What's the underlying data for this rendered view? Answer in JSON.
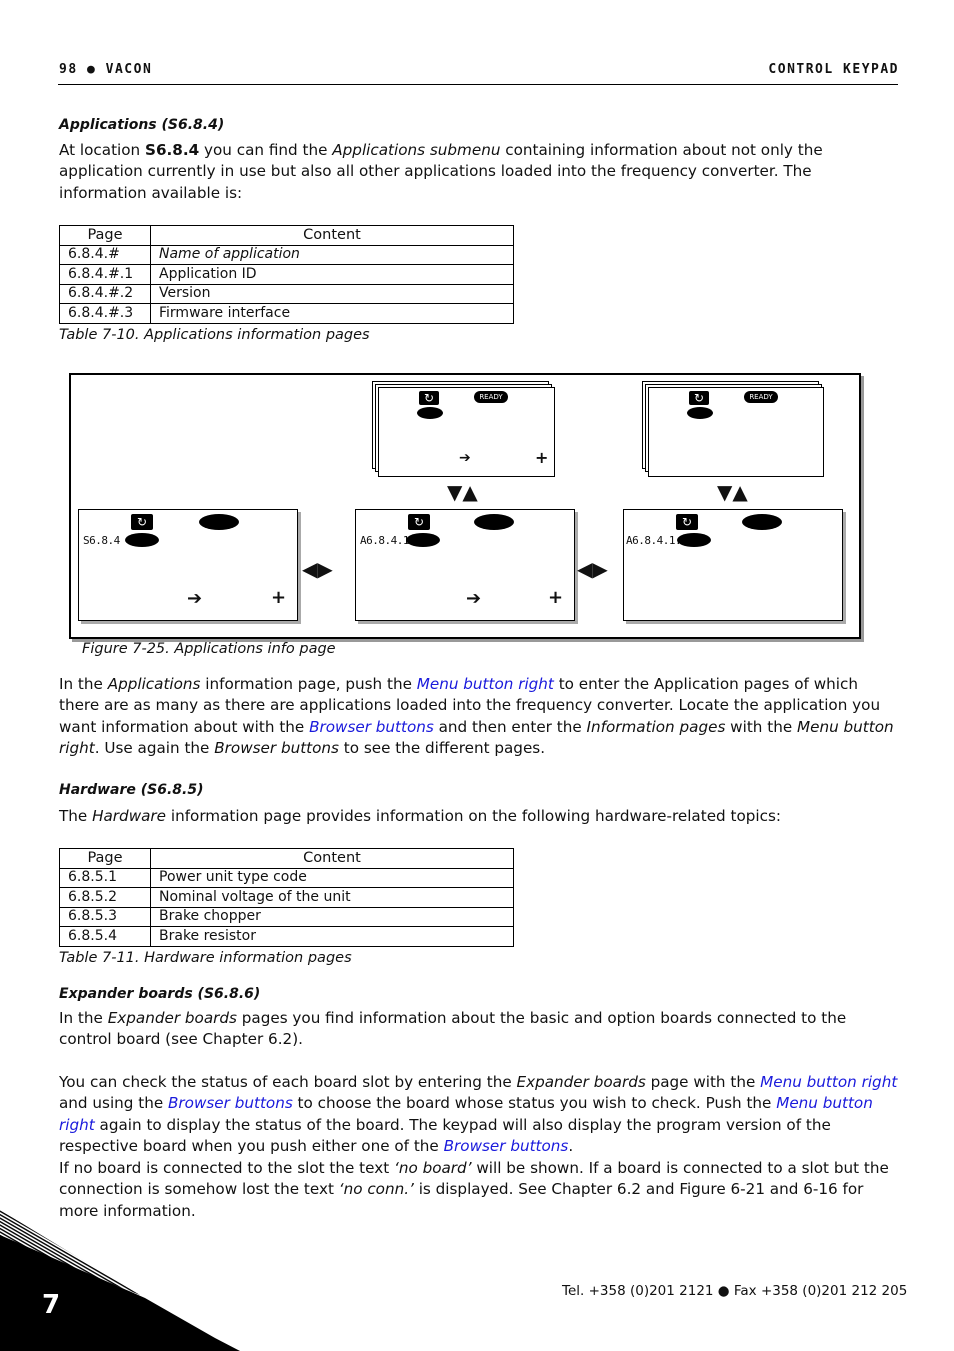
{
  "header": {
    "left": "98 ● VACON",
    "right": "CONTROL KEYPAD"
  },
  "section_applications": {
    "heading": "Applications (S6.8.4)",
    "intro": {
      "t1": "At location ",
      "loc": "S6.8.4",
      "t2": " you can find the ",
      "em1": "Applications submenu",
      "t3": " containing information about not only the application currently in use but also all other applications loaded into the frequency converter. The information available is:"
    },
    "table": {
      "headers": [
        "Page",
        "Content"
      ],
      "rows": [
        {
          "page": "6.8.4.#",
          "content": "Name of application",
          "italic": true
        },
        {
          "page": "6.8.4.#.1",
          "content": "Application ID"
        },
        {
          "page": "6.8.4.#.2",
          "content": "Version"
        },
        {
          "page": "6.8.4.#.3",
          "content": "Firmware interface"
        }
      ],
      "caption": "Table 7-10. Applications information pages"
    }
  },
  "figure": {
    "caption": "Figure 7-25. Applications info page",
    "screens": [
      {
        "code": "S6.8.4"
      },
      {
        "code": "A6.8.4.1"
      },
      {
        "code": "A6.8.4.1.1"
      }
    ],
    "ready_label": "READY",
    "icons": {
      "browse": "▼▲",
      "menu": "◀▶",
      "arrow": "➔",
      "plus": "+"
    }
  },
  "para_applications": {
    "t1": "In the ",
    "em1": "Applications",
    "t2": " information page, push the ",
    "link1": "Menu button right",
    "t3": " to enter the Application pages of which there are as many as there are applications loaded into the frequency converter. Locate the application you want information about with the ",
    "link2": "Browser buttons",
    "t4": " and then enter the ",
    "em2": "Information pages",
    "t5": " with the ",
    "em3": "Menu button right",
    "t6": ". Use again the ",
    "em4": "Browser buttons",
    "t7": " to see the different pages."
  },
  "section_hardware": {
    "heading": "Hardware (S6.8.5)",
    "intro": {
      "t1": "The ",
      "em1": "Hardware",
      "t2": " information page provides information on the following hardware-related topics:"
    },
    "table": {
      "headers": [
        "Page",
        "Content"
      ],
      "rows": [
        {
          "page": "6.8.5.1",
          "content": "Power unit type code"
        },
        {
          "page": "6.8.5.2",
          "content": "Nominal voltage of the unit"
        },
        {
          "page": "6.8.5.3",
          "content": "Brake chopper"
        },
        {
          "page": "6.8.5.4",
          "content": "Brake resistor"
        }
      ],
      "caption": "Table 7-11. Hardware information pages"
    }
  },
  "section_expander": {
    "heading": "Expander boards (S6.8.6)",
    "p1": {
      "t1": "In the ",
      "em1": "Expander boards",
      "t2": " pages you find information about the basic and option boards connected to the control board (see Chapter 6.2)."
    },
    "p2": {
      "t1": "You can check the status of each board slot by entering the ",
      "em1": "Expander boards",
      "t2": " page with the ",
      "link1": "Menu button right",
      "t3": " and using the ",
      "link2": "Browser buttons",
      "t4": " to choose the board whose status you wish to check. Push the ",
      "link3": "Menu button right",
      "t5": " again to display the status of the board. The keypad will also display the program version of the respective board when you push either one of the ",
      "link4": "Browser buttons",
      "t6": "."
    },
    "p3": {
      "t1": "If no board is connected to the slot the text ",
      "em1": "‘no board’",
      "t2": " will be shown. If a board is connected to a slot but the connection is somehow lost the text ",
      "em2": "‘no conn.’",
      "t3": " is displayed. See Chapter 6.2 and Figure 6-21 and 6-16 for more information."
    }
  },
  "footer": {
    "chapter": "7",
    "contact": "Tel. +358 (0)201 2121 ● Fax +358 (0)201 212 205"
  }
}
